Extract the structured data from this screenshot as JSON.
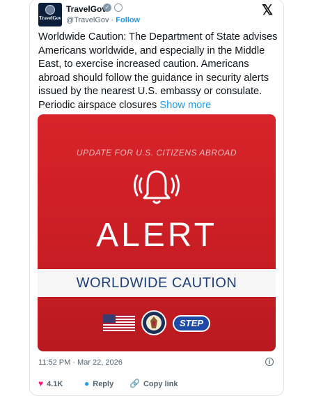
{
  "tweet": {
    "author_name": "TravelGov",
    "handle": "@TravelGov",
    "separator": " · ",
    "follow_label": "Follow",
    "avatar_text": "TravelGov",
    "text": "Worldwide Caution: The Department of State advises Americans worldwide, and especially in the Middle East, to exercise increased caution. Americans abroad should follow the guidance in security alerts issued by the nearest U.S. embassy or consulate.  Periodic airspace closures",
    "show_more_label": "Show more",
    "timestamp": "11:52 PM · Mar 22, 2026",
    "likes_count": "4.1K",
    "reply_label": "Reply",
    "copy_link_label": "Copy link"
  },
  "media": {
    "update_text": "UPDATE FOR U.S. CITIZENS ABROAD",
    "alert_text": "ALERT",
    "caution_text": "WORLDWIDE CAUTION",
    "step_text": "STEP"
  },
  "colors": {
    "accent": "#1d9bf0",
    "heart": "#f91880",
    "alert_red": "#d8232a",
    "caution_blue": "#1f3f7a",
    "step_blue": "#1f4aa6"
  },
  "icons": [
    "verified-badge-icon",
    "government-badge-icon",
    "x-logo-icon",
    "bell-icon",
    "us-flag-icon",
    "state-department-seal-icon",
    "info-icon",
    "heart-icon",
    "reply-icon",
    "link-icon"
  ]
}
